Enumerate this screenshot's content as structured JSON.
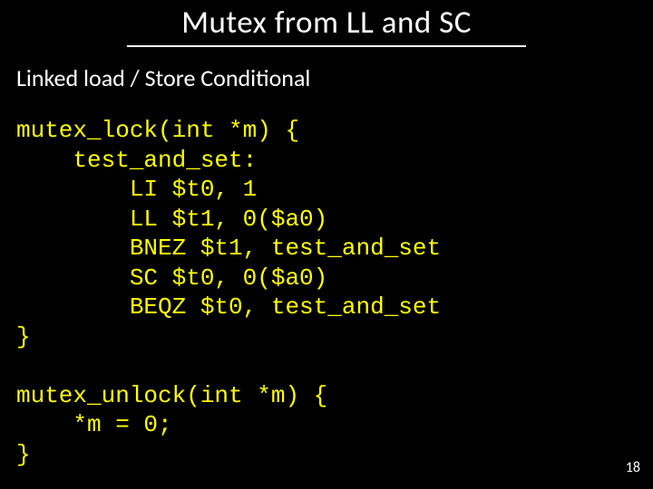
{
  "title": "Mutex from LL and SC",
  "subtitle": "Linked load / Store Conditional",
  "code": {
    "l0": "mutex_lock(int *m) {",
    "l1": "    test_and_set:",
    "l2": "        LI $t0, 1",
    "l3": "        LL $t1, 0($a0)",
    "l4": "        BNEZ $t1, test_and_set",
    "l5": "        SC $t0, 0($a0)",
    "l6": "        BEQZ $t0, test_and_set",
    "l7": "}",
    "l8": "",
    "l9": "mutex_unlock(int *m) {",
    "l10": "    *m = 0;",
    "l11": "}"
  },
  "page_number": "18"
}
